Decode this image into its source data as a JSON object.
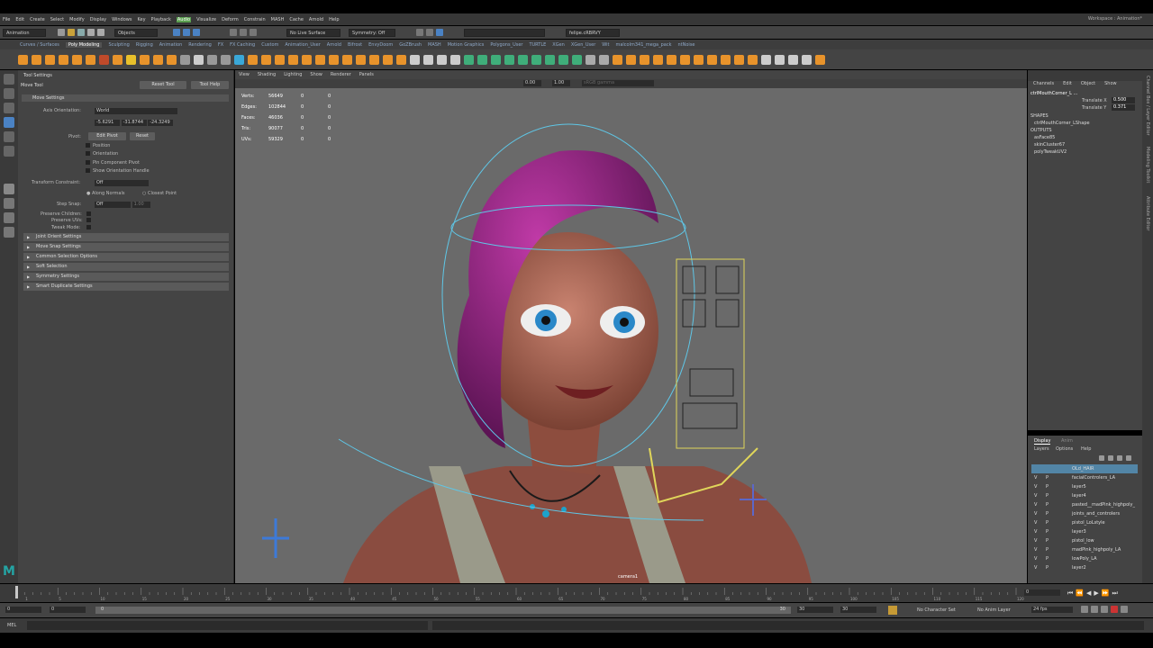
{
  "menubar": {
    "items": [
      "File",
      "Edit",
      "Create",
      "Select",
      "Modify",
      "Display",
      "Windows",
      "Key",
      "Playback",
      "Audio",
      "Visualize",
      "Deform",
      "Constrain",
      "MASH",
      "Cache",
      "Arnold",
      "Help"
    ],
    "highlight_index": 9,
    "workspace": "Workspace : Animation*"
  },
  "statusline": {
    "menuset": "Animation",
    "objects_mode": "Objects",
    "live_surface": "No Live Surface",
    "symmetry": "Symmetry: Off",
    "user": "felipe.cRBRVY"
  },
  "shelf": {
    "tabs": [
      "Curves / Surfaces",
      "Poly Modeling",
      "Sculpting",
      "Rigging",
      "Animation",
      "Rendering",
      "FX",
      "FX Caching",
      "Custom",
      "Animation_User",
      "Arnold",
      "Bifrost",
      "EnvyDoom",
      "GoZBrush",
      "MASH",
      "Motion Graphics",
      "Polygons_User",
      "TURTLE",
      "XGen",
      "XGen_User",
      "Wit",
      "malcolm341_mega_pack",
      "ntNoise"
    ],
    "active_index": 1
  },
  "tool_settings": {
    "header": "Tool Settings",
    "tool_name": "Move Tool",
    "reset_label": "Reset Tool",
    "help_label": "Tool Help",
    "section_title": "Move Settings",
    "axis_orientation_label": "Axis Orientation:",
    "axis_orientation_value": "World",
    "xyz": [
      "-5.6291",
      "-31.8744",
      "-24.3249"
    ],
    "pivot_label": "Pivot:",
    "edit_pivot_label": "Edit Pivot",
    "pivot_reset_label": "Reset",
    "checks": [
      "Position",
      "Orientation",
      "Pin Component Pivot",
      "Show Orientation Handle"
    ],
    "transform_constraint_label": "Transform Constraint:",
    "transform_constraint_value": "Off",
    "along_normals": "Along Normals",
    "closest_point": "Closest Point",
    "step_snap_label": "Step Snap:",
    "step_snap_value": "Off",
    "step_snap_amount": "1.00",
    "preserve_children": "Preserve Children:",
    "preserve_uvs": "Preserve UVs:",
    "tweak_mode": "Tweak Mode:",
    "sections": [
      "Joint Orient Settings",
      "Move Snap Settings",
      "Common Selection Options",
      "Soft Selection",
      "Symmetry Settings",
      "Smart Duplicate Settings"
    ]
  },
  "viewport": {
    "menu": [
      "View",
      "Shading",
      "Lighting",
      "Show",
      "Renderer",
      "Panels"
    ],
    "field_a": "0.00",
    "field_b": "1.00",
    "color_space": "sRGB gamma",
    "stats": [
      {
        "label": "Verts:",
        "v1": "56649",
        "v2": "0",
        "v3": "0"
      },
      {
        "label": "Edges:",
        "v1": "102844",
        "v2": "0",
        "v3": "0"
      },
      {
        "label": "Faces:",
        "v1": "46036",
        "v2": "0",
        "v3": "0"
      },
      {
        "label": "Tris:",
        "v1": "90077",
        "v2": "0",
        "v3": "0"
      },
      {
        "label": "UVs:",
        "v1": "59329",
        "v2": "0",
        "v3": "0"
      }
    ],
    "camera": "camera1"
  },
  "channel_box": {
    "tabs": [
      "Channels",
      "Edit",
      "Object",
      "Show"
    ],
    "object": "ctrlMouthCorner_L ...",
    "attrs": [
      {
        "name": "Translate X",
        "value": "0.500"
      },
      {
        "name": "Translate Y",
        "value": "0.371"
      }
    ],
    "shapes_label": "SHAPES",
    "shape": "ctrlMouthCorner_LShape",
    "outputs_label": "OUTPUTS",
    "outputs": [
      "asFace85",
      "skinCluster67",
      "polyTweakUV2"
    ]
  },
  "side_tabs": [
    "Channel Box / Layer Editor",
    "Modeling Toolkit",
    "Attribute Editor"
  ],
  "layers": {
    "tabs": [
      "Display",
      "Anim"
    ],
    "menu": [
      "Layers",
      "Options",
      "Help"
    ],
    "rows": [
      {
        "v": "",
        "p": "",
        "name": "OLd_HAIR",
        "selected": true
      },
      {
        "v": "V",
        "p": "P",
        "name": "facialControlers_LA"
      },
      {
        "v": "V",
        "p": "P",
        "name": "layer5"
      },
      {
        "v": "V",
        "p": "P",
        "name": "layer4"
      },
      {
        "v": "V",
        "p": "P",
        "name": "pasted__madPink_highpoly_"
      },
      {
        "v": "V",
        "p": "P",
        "name": "joints_and_controlers"
      },
      {
        "v": "V",
        "p": "P",
        "name": "pistol_LoLstyle"
      },
      {
        "v": "V",
        "p": "P",
        "name": "layer3"
      },
      {
        "v": "V",
        "p": "P",
        "name": "pistol_low"
      },
      {
        "v": "V",
        "p": "P",
        "name": "madPink_highpoly_LA"
      },
      {
        "v": "V",
        "p": "P",
        "name": "lowPoly_LA"
      },
      {
        "v": "V",
        "p": "P",
        "name": "layer2"
      }
    ]
  },
  "timeline": {
    "current_frame": "0",
    "range_start": "0",
    "range_start2": "0",
    "range_inner_start": "0",
    "range_inner_end": "30",
    "range_end": "30",
    "range_end2": "30",
    "fps": "24 fps",
    "character_set": "No Character Set",
    "anim_layer": "No Anim Layer",
    "ticks": [
      1,
      5,
      10,
      15,
      20,
      25,
      30,
      35,
      40,
      45,
      50,
      55,
      60,
      65,
      70,
      75,
      80,
      85,
      90,
      95,
      100,
      105,
      110,
      115,
      120
    ]
  },
  "cmdline": {
    "lang": "MEL"
  },
  "colors": {
    "accent": "#5a9f4f",
    "shelf_orange": "#e8932b",
    "shelf_green": "#3fae7a",
    "hair": "#a3268d"
  }
}
